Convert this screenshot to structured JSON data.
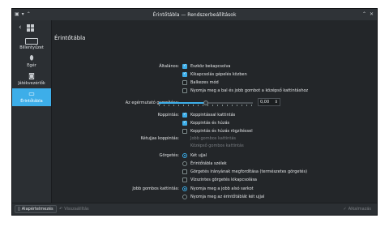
{
  "window": {
    "title": "Érintőtábla — Rendszerbeállítások"
  },
  "sidebar": {
    "items": [
      {
        "label": "Billentyűzet",
        "icon": "keyboard-icon"
      },
      {
        "label": "Egér",
        "icon": "mouse-icon"
      },
      {
        "label": "Játékvezérlők",
        "icon": "gamepad-icon"
      },
      {
        "label": "Érintőtábla",
        "icon": "touchpad-icon"
      }
    ]
  },
  "page": {
    "title": "Érintőtábla"
  },
  "general": {
    "label": "Általános:",
    "options": [
      {
        "text": "Eszköz bekapcsolva",
        "checked": true
      },
      {
        "text": "Kikapcsolás gépelés közben",
        "checked": true
      },
      {
        "text": "Balkezes mód",
        "checked": false
      },
      {
        "text": "Nyomja meg a bal és jobb gombot a középső kattintáshoz",
        "checked": false
      }
    ]
  },
  "speed": {
    "label": "Az egérmutató gyorsítása:",
    "value": "0,00",
    "position": 0.5
  },
  "tapping": {
    "label": "Koppintás:",
    "options": [
      {
        "text": "Koppintással kattintás",
        "checked": true
      },
      {
        "text": "Koppintás és húzás",
        "checked": true
      },
      {
        "text": "Koppintás és húzás rögzítéssel",
        "checked": false
      }
    ]
  },
  "two_finger": {
    "label": "Kétujjas koppintás:",
    "options": [
      {
        "text": "Jobb gombos kattintás"
      },
      {
        "text": "Középső gombos kattintás"
      }
    ]
  },
  "scrolling": {
    "label": "Görgetés:",
    "options": [
      {
        "text": "Két ujjal",
        "checked": true,
        "type": "radio"
      },
      {
        "text": "Érintőtábla szélek",
        "checked": false,
        "type": "radio"
      },
      {
        "text": "Görgetés irányának megfordítása (természetes görgetés)",
        "checked": false,
        "type": "check"
      },
      {
        "text": "Vízszintes görgetés kikapcsolása",
        "checked": false,
        "type": "check"
      }
    ]
  },
  "right_click": {
    "label": "Jobb gombos kattintás:",
    "options": [
      {
        "text": "Nyomja meg a jobb alsó sarkot",
        "checked": true
      },
      {
        "text": "Nyomja meg az érintőtáblát két ujjal",
        "checked": false
      }
    ]
  },
  "footer": {
    "defaults": "Alapértelmezés",
    "reset": "Visszaállítás",
    "apply": "Alkalmazás"
  }
}
